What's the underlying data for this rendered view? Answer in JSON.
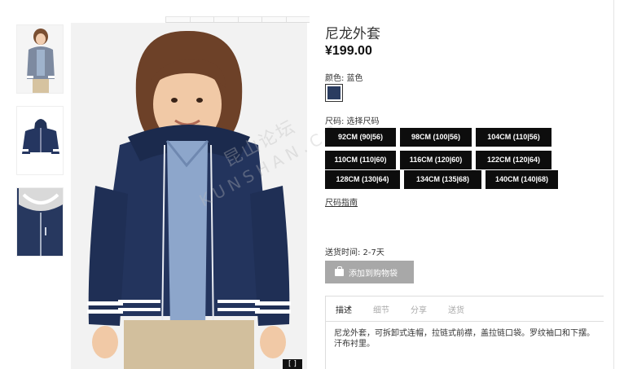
{
  "product": {
    "title": "尼龙外套",
    "price": "¥199.00"
  },
  "color": {
    "label": "颜色: 蓝色",
    "swatch_hex": "#2a3c60"
  },
  "size": {
    "label": "尺码: 选择尺码",
    "options": [
      "92CM (90|56)",
      "98CM (100|56)",
      "104CM (110|56)",
      "110CM (110|60)",
      "116CM (120|60)",
      "122CM (120|64)",
      "128CM (130|64)",
      "134CM (135|68)",
      "140CM (140|68)"
    ],
    "guide_link": "尺码指南"
  },
  "delivery": "送货时间: 2-7天",
  "add_to_bag": "添加到购物袋",
  "details": {
    "tabs": [
      "描述",
      "细节",
      "分享",
      "送货"
    ],
    "active_tab": 0,
    "description": "尼龙外套，可拆卸式连帽，拉链式前襟，盖拉链口袋。罗纹袖口和下摆。汗布衬里。"
  },
  "watermark": {
    "cn": "昆山论坛",
    "en": "KUNSHAN.CC"
  },
  "colors": {
    "navy": "#2a3c60",
    "button_black": "#0d0d0d",
    "button_disabled": "#a8a8a8"
  }
}
